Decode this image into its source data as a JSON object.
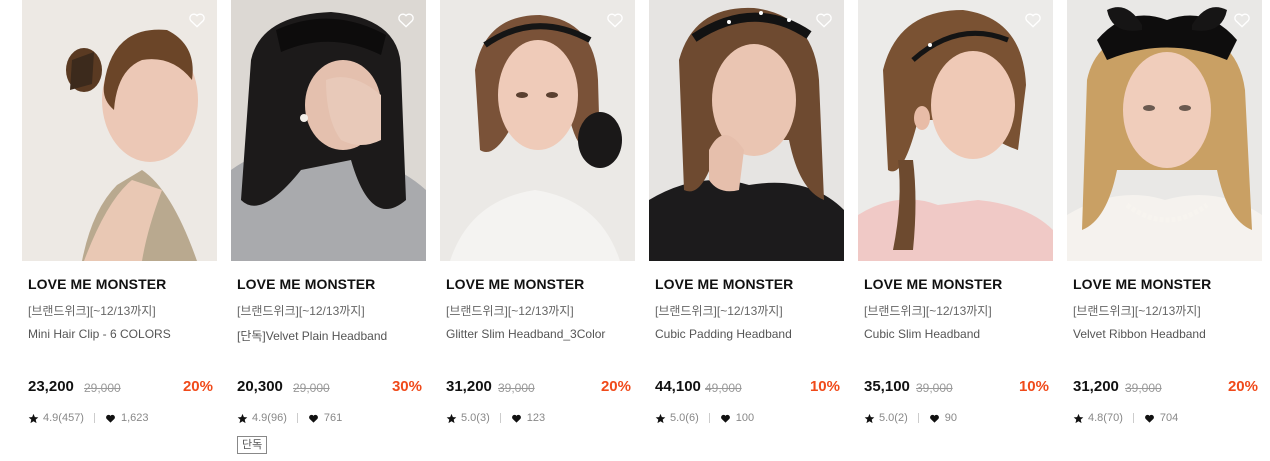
{
  "products": [
    {
      "image": "woman with hair clip in profile",
      "brand": "LOVE ME MONSTER",
      "promo": "[브랜드위크][~12/13까지]",
      "name": "Mini Hair Clip - 6 COLORS",
      "price": "23,200",
      "original_price": "29,000",
      "discount": "20%",
      "rating": "4.9(457)",
      "likes": "1,623",
      "tag": ""
    },
    {
      "image": "woman in velvet headband covering face",
      "brand": "LOVE ME MONSTER",
      "promo": "[브랜드위크][~12/13까지]",
      "name": "[단독]Velvet Plain Headband",
      "price": "20,300",
      "original_price": "29,000",
      "discount": "30%",
      "rating": "4.9(96)",
      "likes": "761",
      "tag": "단독"
    },
    {
      "image": "woman in slim headband with scrunchie",
      "brand": "LOVE ME MONSTER",
      "promo": "[브랜드위크][~12/13까지]",
      "name": "Glitter Slim Headband_3Color",
      "price": "31,200",
      "original_price": "39,000",
      "discount": "20%",
      "rating": "5.0(3)",
      "likes": "123",
      "tag": ""
    },
    {
      "image": "woman in cubic padding headband",
      "brand": "LOVE ME MONSTER",
      "promo": "[브랜드위크][~12/13까지]",
      "name": "Cubic Padding Headband",
      "price": "44,100",
      "original_price": "49,000",
      "discount": "10%",
      "rating": "5.0(6)",
      "likes": "100",
      "tag": ""
    },
    {
      "image": "woman in cubic slim headband with braid",
      "brand": "LOVE ME MONSTER",
      "promo": "[브랜드위크][~12/13까지]",
      "name": "Cubic Slim Headband",
      "price": "35,100",
      "original_price": "39,000",
      "discount": "10%",
      "rating": "5.0(2)",
      "likes": "90",
      "tag": ""
    },
    {
      "image": "woman in velvet ribbon headband with pearls",
      "brand": "LOVE ME MONSTER",
      "promo": "[브랜드위크][~12/13까지]",
      "name": "Velvet Ribbon Headband",
      "price": "31,200",
      "original_price": "39,000",
      "discount": "20%",
      "rating": "4.8(70)",
      "likes": "704",
      "tag": ""
    }
  ],
  "icons": {
    "wishlist": "heart-outline-icon",
    "rating": "star-icon",
    "likes": "heart-filled-icon"
  },
  "colors": {
    "discount": "#f04a1a",
    "text": "#111111",
    "muted": "#888888"
  }
}
